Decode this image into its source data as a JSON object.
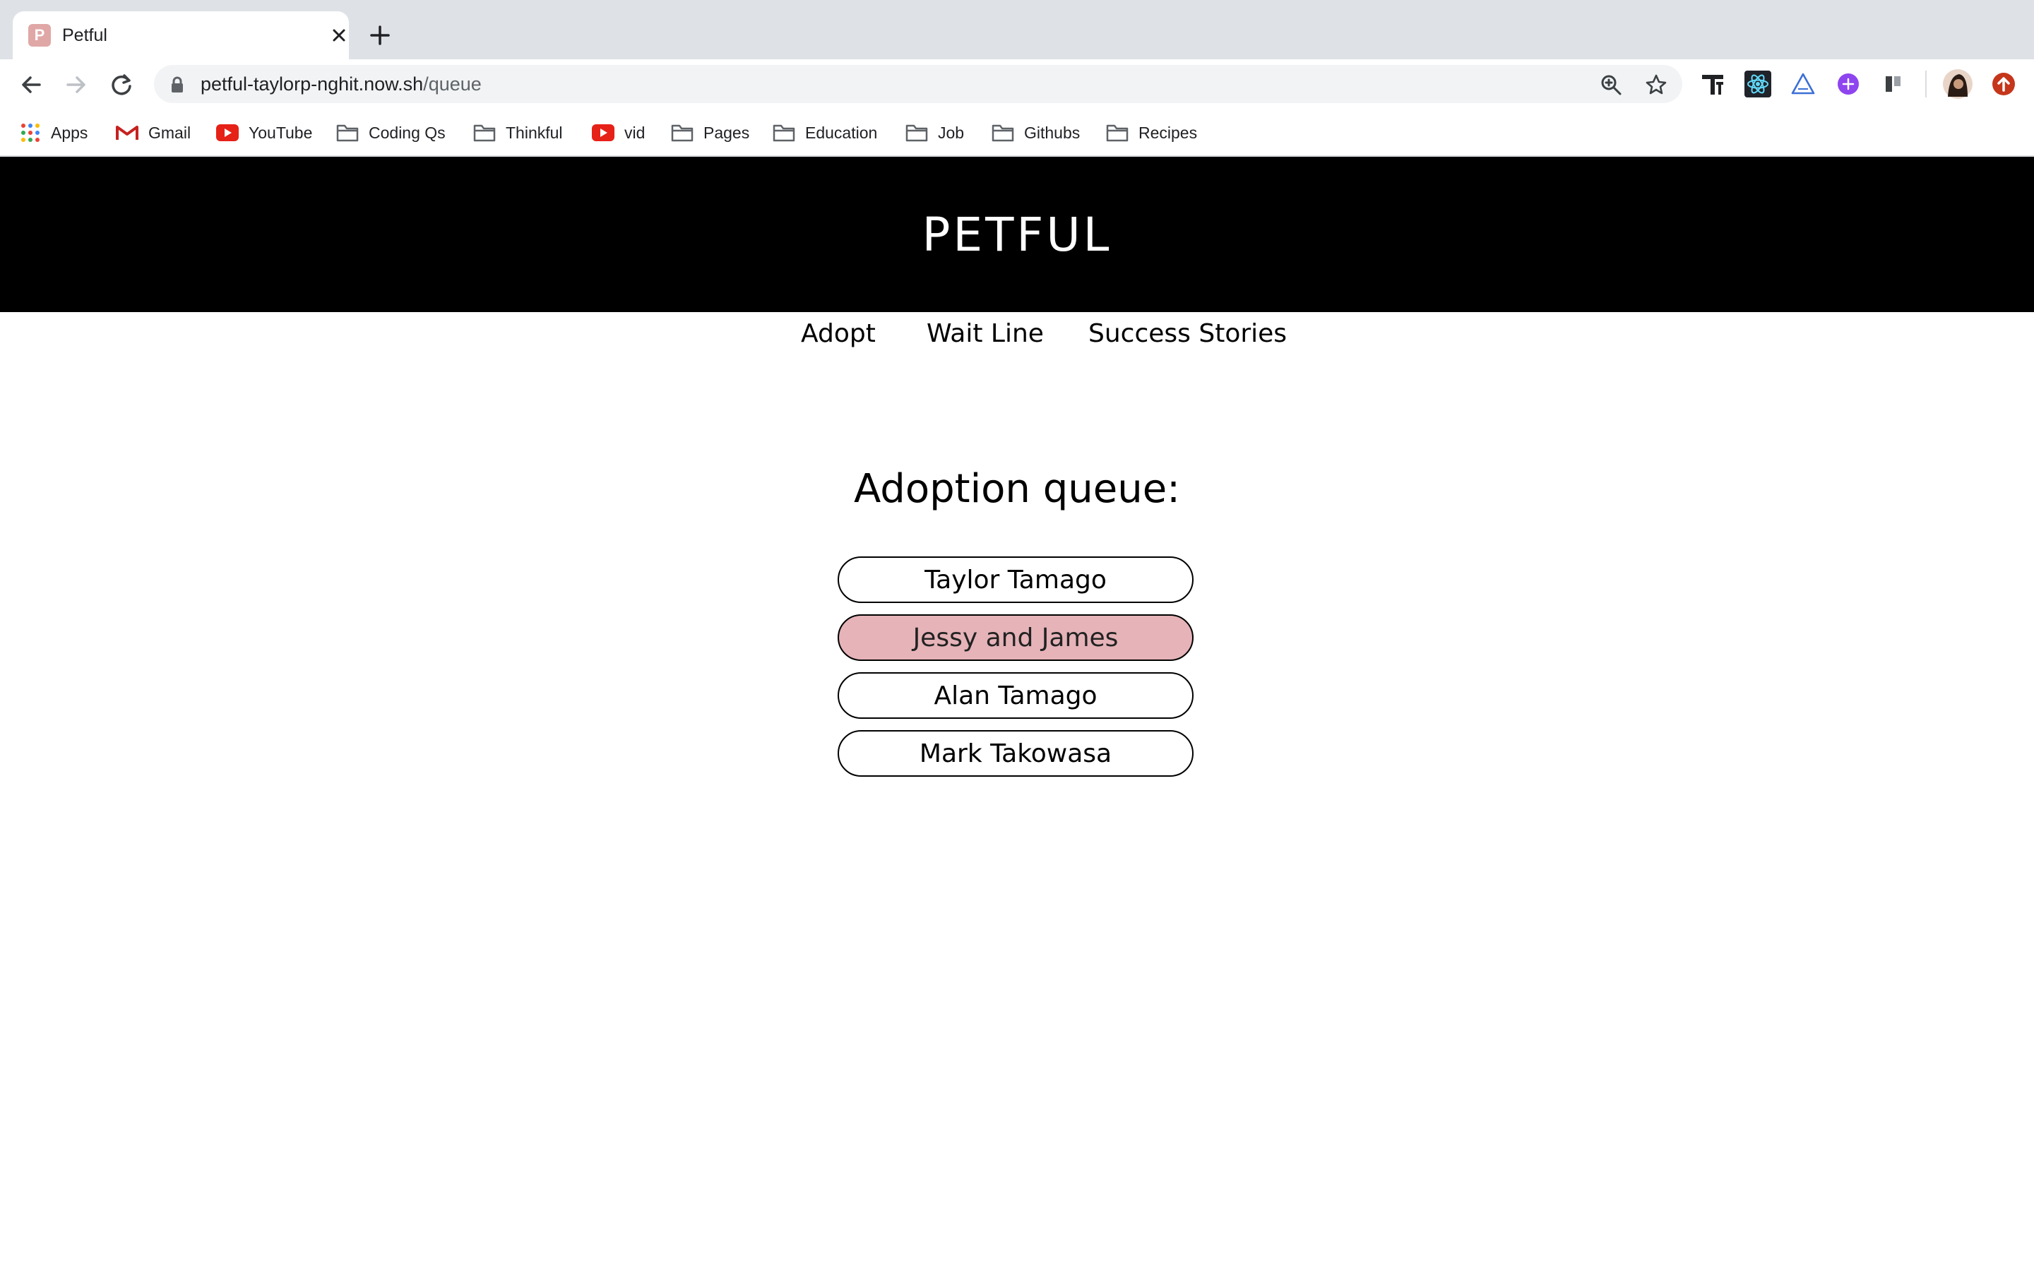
{
  "browser": {
    "tab": {
      "title": "Petful",
      "favicon_letter": "P"
    },
    "url": {
      "host": "petful-taylorp-nghit.now.sh",
      "path": "/queue"
    },
    "bookmarks": [
      {
        "label": "Apps",
        "icon": "apps-grid-icon"
      },
      {
        "label": "Gmail",
        "icon": "gmail-icon"
      },
      {
        "label": "YouTube",
        "icon": "youtube-icon"
      },
      {
        "label": "Coding Qs",
        "icon": "folder-icon"
      },
      {
        "label": "Thinkful",
        "icon": "folder-icon"
      },
      {
        "label": "vid",
        "icon": "youtube-icon"
      },
      {
        "label": "Pages",
        "icon": "folder-icon"
      },
      {
        "label": "Education",
        "icon": "folder-icon"
      },
      {
        "label": "Job",
        "icon": "folder-icon"
      },
      {
        "label": "Githubs",
        "icon": "folder-icon"
      },
      {
        "label": "Recipes",
        "icon": "folder-icon"
      }
    ]
  },
  "site": {
    "title": "PETFUL",
    "nav": [
      "Adopt",
      "Wait Line",
      "Success Stories"
    ],
    "queue_heading": "Adoption queue:",
    "queue": [
      {
        "name": "Taylor Tamago",
        "current": false
      },
      {
        "name": "Jessy and James",
        "current": true
      },
      {
        "name": "Alan Tamago",
        "current": false
      },
      {
        "name": "Mark Takowasa",
        "current": false
      }
    ]
  },
  "colors": {
    "header_bg": "#000000",
    "current_highlight": "#e5b3b8",
    "tabstrip_bg": "#dee1e6"
  }
}
